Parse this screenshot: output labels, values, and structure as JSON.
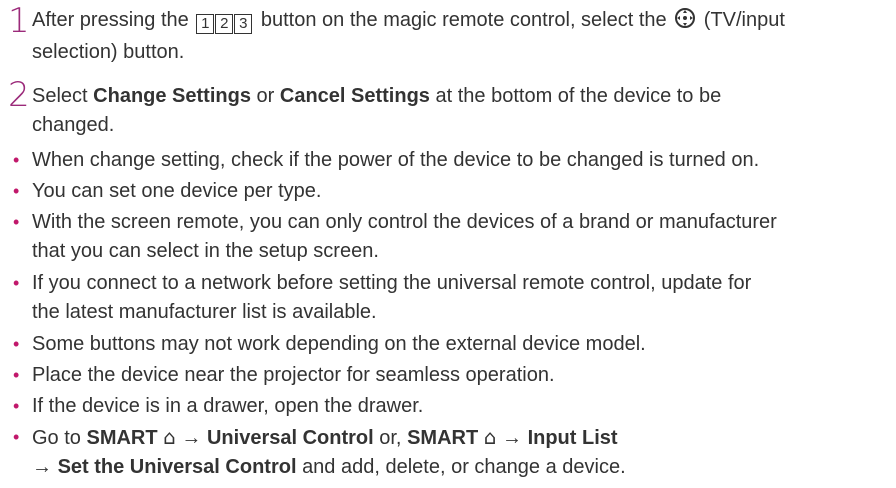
{
  "steps": [
    {
      "number": "1",
      "text_before": "After pressing the",
      "key_digits": [
        "1",
        "2",
        "3"
      ],
      "text_middle": "button on the magic remote control, select the",
      "icon": "tv-input-selection-icon",
      "text_after_line1": "(TV/input",
      "text_after_line2": "selection) button."
    },
    {
      "number": "2",
      "text_before": "Select",
      "bold1": "Change Settings",
      "or": "or",
      "bold2": "Cancel Settings",
      "text_after_line1": "at the bottom of the device to be",
      "text_after_line2": "changed."
    }
  ],
  "bullets": [
    {
      "text": "When change setting, check if the power of the device to be changed is turned on."
    },
    {
      "text": "You can set one device per type."
    },
    {
      "line1": "With the screen remote, you can only control the devices of a brand or manufacturer",
      "line2": "that you can select in the setup screen."
    },
    {
      "line1": "If you connect to a network before setting the universal remote control, update for",
      "line2": "the latest manufacturer list is available."
    },
    {
      "text": "Some buttons may not work depending on the external device model."
    },
    {
      "text": "Place the device near the projector for seamless operation."
    },
    {
      "text": "If the device is in a drawer, open the drawer."
    }
  ],
  "last_bullet": {
    "go_to": "Go to",
    "smart1": "SMART",
    "arrow1": "→",
    "universal_control": "Universal Control",
    "or_comma": "or,",
    "smart2": "SMART",
    "arrow2": "→",
    "input_list": "Input List",
    "arrow3": "→",
    "set_universal": "Set the Universal Control",
    "tail": "and add, delete, or change a device.",
    "home_icon_glyph": "⌂"
  },
  "bullet_glyph": "•",
  "colors": {
    "step_number": "#9b2a7a",
    "bullet": "#c1186b",
    "text": "#333333"
  }
}
